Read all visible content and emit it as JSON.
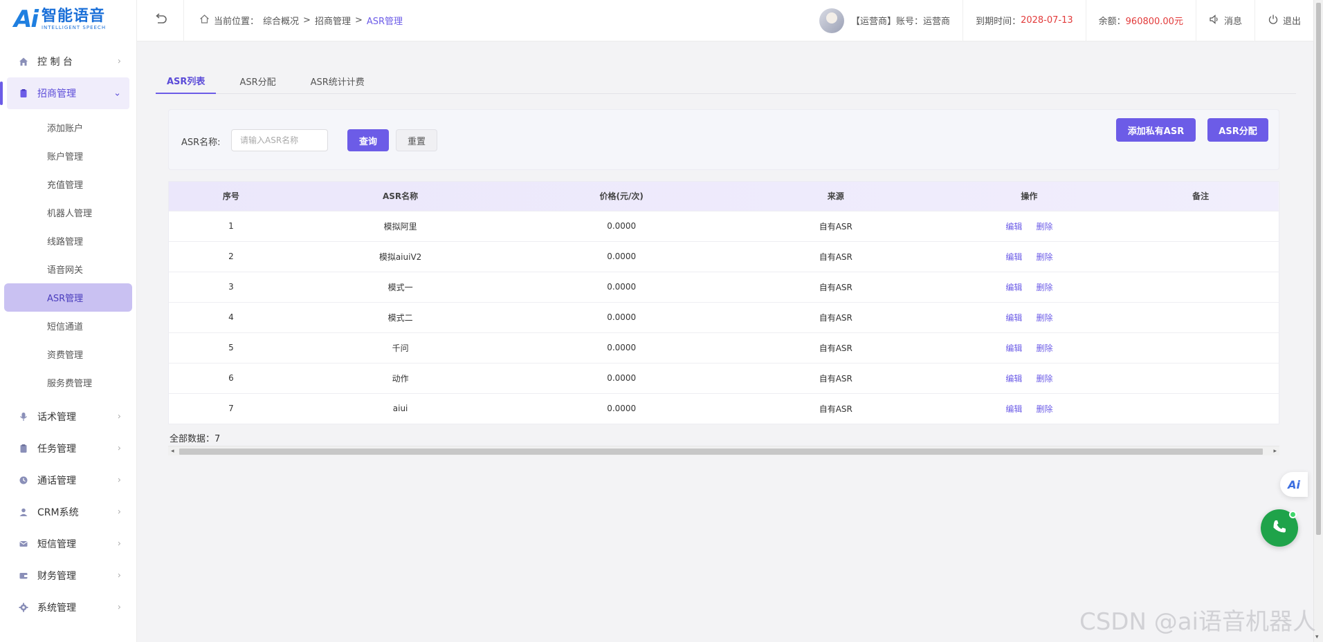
{
  "logo": {
    "mark": "Ai",
    "cn": "智能语音",
    "en": "INTELLIGENT SPEECH"
  },
  "sidebar": {
    "top_items": [
      {
        "label": "控 制 台"
      }
    ],
    "group": {
      "label": "招商管理"
    },
    "sub_items": [
      {
        "label": "添加账户"
      },
      {
        "label": "账户管理"
      },
      {
        "label": "充值管理"
      },
      {
        "label": "机器人管理"
      },
      {
        "label": "线路管理"
      },
      {
        "label": "语音网关"
      },
      {
        "label": "ASR管理"
      },
      {
        "label": "短信通道"
      },
      {
        "label": "资费管理"
      },
      {
        "label": "服务费管理"
      }
    ],
    "bottom_items": [
      {
        "label": "话术管理"
      },
      {
        "label": "任务管理"
      },
      {
        "label": "通话管理"
      },
      {
        "label": "CRM系统"
      },
      {
        "label": "短信管理"
      },
      {
        "label": "财务管理"
      },
      {
        "label": "系统管理"
      }
    ]
  },
  "header": {
    "breadcrumb_prefix": "当前位置：",
    "crumb1": "综合概况",
    "sep": ">",
    "crumb2": "招商管理",
    "crumb3": "ASR管理",
    "user_text": "【运营商】账号：运营商",
    "expire_label": "到期时间：",
    "expire_value": "2028-07-13",
    "balance_label": "余额：",
    "balance_value": "960800.00元",
    "message": "消息",
    "logout": "退出"
  },
  "tabs": [
    {
      "label": "ASR列表"
    },
    {
      "label": "ASR分配"
    },
    {
      "label": "ASR统计计费"
    }
  ],
  "search": {
    "label": "ASR名称:",
    "placeholder": "请输入ASR名称",
    "query": "查询",
    "reset": "重置",
    "add_private": "添加私有ASR",
    "assign": "ASR分配"
  },
  "table": {
    "headers": [
      "序号",
      "ASR名称",
      "价格(元/次)",
      "来源",
      "操作",
      "备注"
    ],
    "edit": "编辑",
    "delete": "删除",
    "rows": [
      {
        "no": "1",
        "name": "模拟阿里",
        "price": "0.0000",
        "source": "自有ASR",
        "note": ""
      },
      {
        "no": "2",
        "name": "模拟aiuiV2",
        "price": "0.0000",
        "source": "自有ASR",
        "note": ""
      },
      {
        "no": "3",
        "name": "模式一",
        "price": "0.0000",
        "source": "自有ASR",
        "note": ""
      },
      {
        "no": "4",
        "name": "模式二",
        "price": "0.0000",
        "source": "自有ASR",
        "note": ""
      },
      {
        "no": "5",
        "name": "千问",
        "price": "0.0000",
        "source": "自有ASR",
        "note": ""
      },
      {
        "no": "6",
        "name": "动作",
        "price": "0.0000",
        "source": "自有ASR",
        "note": ""
      },
      {
        "no": "7",
        "name": "aiui",
        "price": "0.0000",
        "source": "自有ASR",
        "note": ""
      }
    ],
    "total": "全部数据：7"
  },
  "float": {
    "ai": "Ai"
  },
  "watermark": "CSDN @ai语音机器人",
  "colors": {
    "accent": "#6c5ce7",
    "danger": "#e23a3a",
    "phone": "#1fa34a"
  }
}
